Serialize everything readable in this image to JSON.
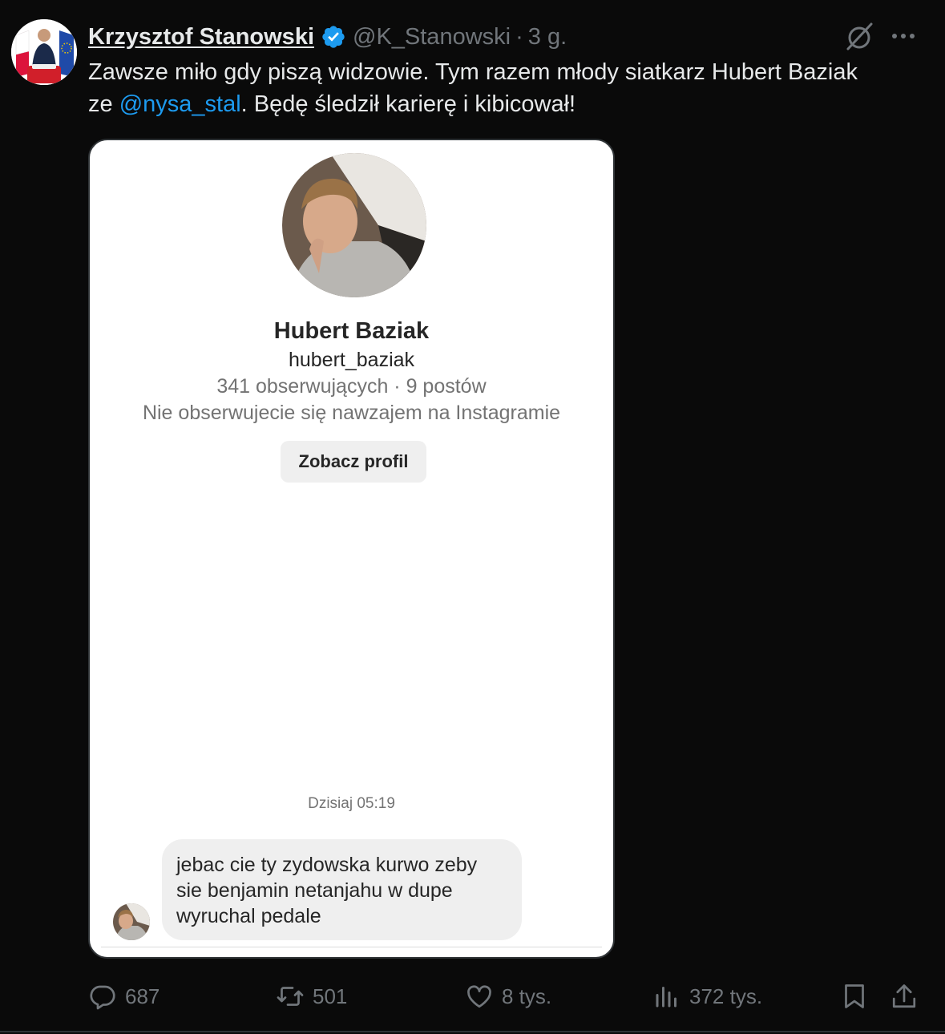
{
  "author": {
    "display_name": "Krzysztof Stanowski",
    "handle": "@K_Stanowski",
    "separator": "·",
    "time": "3 g."
  },
  "tweet": {
    "text_line1": "Zawsze miło gdy piszą widzowie. Tym razem młody siatkarz Hubert Baziak",
    "text_prefix": "ze ",
    "mention": "@nysa_stal",
    "text_suffix": ". Będę śledził karierę i kibicował!"
  },
  "screenshot": {
    "profile_name": "Hubert Baziak",
    "username": "hubert_baziak",
    "stats": "341 obserwujących · 9 postów",
    "mutual": "Nie obserwujecie się nawzajem na Instagramie",
    "button_label": "Zobacz profil",
    "date": "Dzisiaj 05:19",
    "message_lines": [
      "jebac cie ty zydowska kurwo zeby",
      "sie benjamin netanjahu w dupe",
      "wyruchal pedale"
    ]
  },
  "actions": {
    "replies": "687",
    "reposts": "501",
    "likes": "8 tys.",
    "views": "372 tys."
  },
  "colors": {
    "background": "#0a0a0a",
    "text": "#e7e9ea",
    "secondary": "#71767b",
    "accent": "#1d9bf0",
    "verified": "#1d9bf0"
  },
  "icons": [
    "verified-badge-icon",
    "grok-icon",
    "more-icon",
    "reply-icon",
    "repost-icon",
    "like-icon",
    "views-icon",
    "bookmark-icon",
    "share-icon"
  ]
}
